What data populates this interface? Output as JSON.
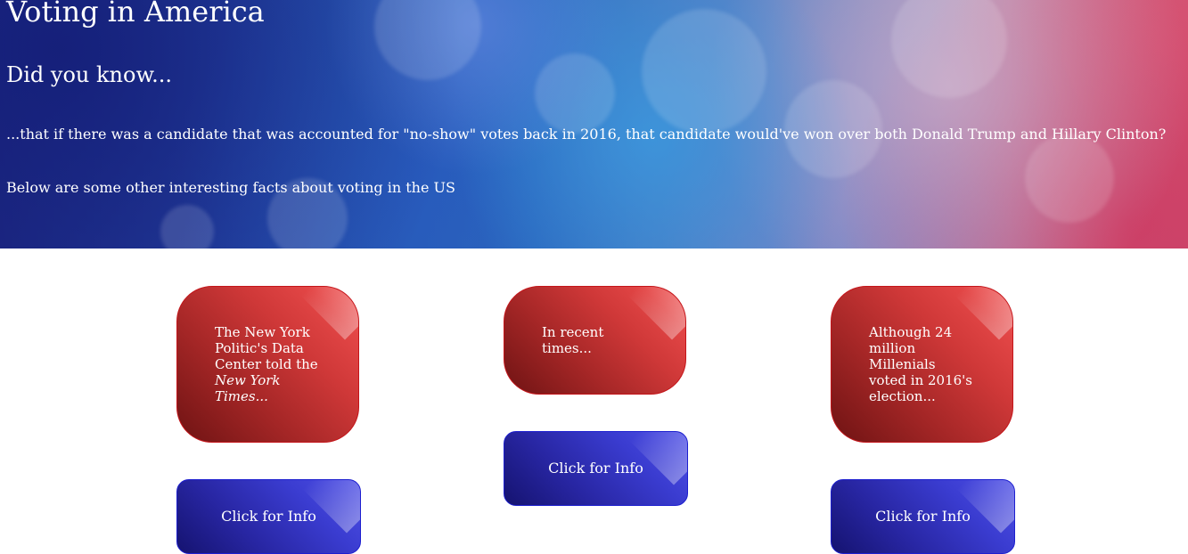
{
  "hero": {
    "title": "Voting in America",
    "subtitle": "Did you know...",
    "fact": "...that if there was a candidate that was accounted for \"no-show\" votes back in 2016, that candidate would've won over both Donald Trump and Hillary Clinton?",
    "intro": "Below are some other interesting facts about voting in the US"
  },
  "cards": [
    {
      "text_before": "The New York Politic's Data Center told the ",
      "text_italic": "New York Times...",
      "button_label": "Click for Info"
    },
    {
      "text_before": "In recent times...",
      "text_italic": "",
      "button_label": "Click for Info"
    },
    {
      "text_before": "Although 24 million Millenials voted in 2016's election...",
      "text_italic": "",
      "button_label": "Click for Info"
    }
  ],
  "colors": {
    "card_red": "#d03a3a",
    "button_blue": "#2d2eb8",
    "hero_blue": "#2547a8",
    "hero_pink": "#c9536f"
  }
}
